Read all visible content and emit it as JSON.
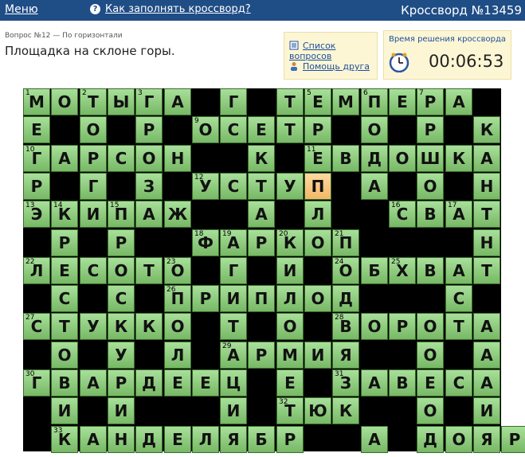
{
  "header": {
    "menu_label": "Меню",
    "howto_label": "Как заполнять кроссворд?",
    "title": "Кроссворд №13459"
  },
  "question": {
    "meta": "Вопрос №12 — По горизонтали",
    "text": "Площадка на склоне горы."
  },
  "links": {
    "questions_list": "Список вопросов",
    "friend_help": "Помощь друга"
  },
  "timer": {
    "label": "Время решения кроссворда",
    "value": "00:06:53"
  },
  "grid": {
    "cols": 17,
    "rows": 13,
    "selected": [
      3,
      10
    ],
    "cells": [
      "МОТЫГА.Г.ТЕМПЕРА",
      "Е.О.Р.ОСЕТР.О.Р.К",
      "ГАРСОН..К.ЕВДОШКА",
      "Р.Г.З.УСТУП.А.О.Н",
      "ЭКИПАЖ..А.Л..СВАТ",
      ".Р.Р..ФАРКОП....Н",
      "ЛЕСОТО.Г.И.ОБХВАТ",
      ".С.С.ПРИПЛОД...С.",
      "СТУККО.Т.О.ВОРОТА",
      ".О.У.Л.АРМИЯ..О.А",
      "ГВАРДЕЕЦ.Е.ЗАВЕСА",
      ".И.И...И.ТЮК..О.И",
      ".КАНДЕЛЯБР..А.ДОЯР"
    ],
    "numbers": [
      {
        "r": 0,
        "c": 0,
        "n": "1"
      },
      {
        "r": 0,
        "c": 2,
        "n": "2"
      },
      {
        "r": 0,
        "c": 4,
        "n": "3"
      },
      {
        "r": 0,
        "c": 8,
        "n": "4"
      },
      {
        "r": 0,
        "c": 10,
        "n": "5"
      },
      {
        "r": 0,
        "c": 12,
        "n": "6"
      },
      {
        "r": 0,
        "c": 14,
        "n": "7"
      },
      {
        "r": 0,
        "c": 16,
        "n": "8"
      },
      {
        "r": 1,
        "c": 6,
        "n": "9"
      },
      {
        "r": 2,
        "c": 0,
        "n": "10"
      },
      {
        "r": 2,
        "c": 10,
        "n": "11"
      },
      {
        "r": 3,
        "c": 6,
        "n": "12"
      },
      {
        "r": 4,
        "c": 0,
        "n": "13"
      },
      {
        "r": 4,
        "c": 1,
        "n": "14"
      },
      {
        "r": 4,
        "c": 3,
        "n": "15"
      },
      {
        "r": 4,
        "c": 13,
        "n": "16"
      },
      {
        "r": 4,
        "c": 15,
        "n": "17"
      },
      {
        "r": 5,
        "c": 6,
        "n": "18"
      },
      {
        "r": 5,
        "c": 7,
        "n": "19"
      },
      {
        "r": 5,
        "c": 9,
        "n": "20"
      },
      {
        "r": 5,
        "c": 11,
        "n": "21"
      },
      {
        "r": 6,
        "c": 0,
        "n": "22"
      },
      {
        "r": 6,
        "c": 5,
        "n": "23"
      },
      {
        "r": 6,
        "c": 11,
        "n": "24"
      },
      {
        "r": 6,
        "c": 13,
        "n": "25"
      },
      {
        "r": 7,
        "c": 5,
        "n": "26"
      },
      {
        "r": 8,
        "c": 0,
        "n": "27"
      },
      {
        "r": 8,
        "c": 11,
        "n": "28"
      },
      {
        "r": 9,
        "c": 7,
        "n": "29"
      },
      {
        "r": 10,
        "c": 0,
        "n": "30"
      },
      {
        "r": 10,
        "c": 11,
        "n": "31"
      },
      {
        "r": 11,
        "c": 9,
        "n": "32"
      },
      {
        "r": 12,
        "c": 1,
        "n": "33"
      },
      {
        "r": 12,
        "c": 13,
        "n": "34"
      }
    ]
  },
  "colors": {
    "header": "#1f4d86",
    "cell": "#8fcc7d",
    "selected": "#f6c983",
    "block": "#000000"
  }
}
